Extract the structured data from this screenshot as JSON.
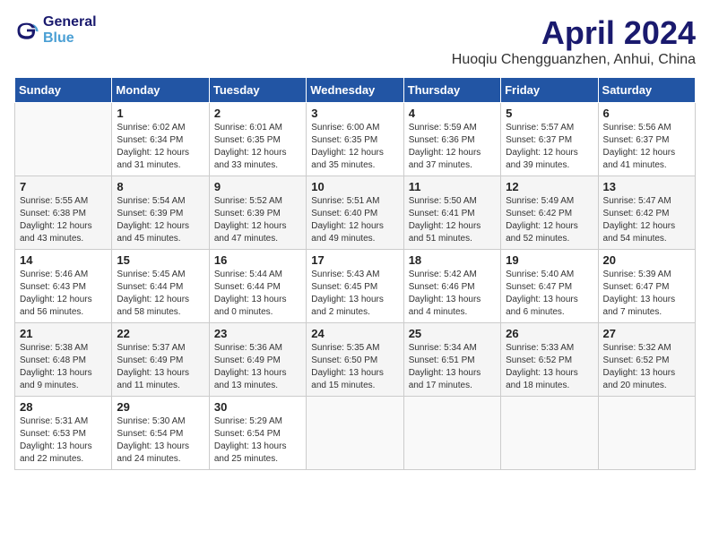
{
  "header": {
    "logo_line1": "General",
    "logo_line2": "Blue",
    "title": "April 2024",
    "location": "Huoqiu Chengguanzhen, Anhui, China"
  },
  "columns": [
    "Sunday",
    "Monday",
    "Tuesday",
    "Wednesday",
    "Thursday",
    "Friday",
    "Saturday"
  ],
  "weeks": [
    [
      {
        "day": "",
        "info": ""
      },
      {
        "day": "1",
        "info": "Sunrise: 6:02 AM\nSunset: 6:34 PM\nDaylight: 12 hours\nand 31 minutes."
      },
      {
        "day": "2",
        "info": "Sunrise: 6:01 AM\nSunset: 6:35 PM\nDaylight: 12 hours\nand 33 minutes."
      },
      {
        "day": "3",
        "info": "Sunrise: 6:00 AM\nSunset: 6:35 PM\nDaylight: 12 hours\nand 35 minutes."
      },
      {
        "day": "4",
        "info": "Sunrise: 5:59 AM\nSunset: 6:36 PM\nDaylight: 12 hours\nand 37 minutes."
      },
      {
        "day": "5",
        "info": "Sunrise: 5:57 AM\nSunset: 6:37 PM\nDaylight: 12 hours\nand 39 minutes."
      },
      {
        "day": "6",
        "info": "Sunrise: 5:56 AM\nSunset: 6:37 PM\nDaylight: 12 hours\nand 41 minutes."
      }
    ],
    [
      {
        "day": "7",
        "info": "Sunrise: 5:55 AM\nSunset: 6:38 PM\nDaylight: 12 hours\nand 43 minutes."
      },
      {
        "day": "8",
        "info": "Sunrise: 5:54 AM\nSunset: 6:39 PM\nDaylight: 12 hours\nand 45 minutes."
      },
      {
        "day": "9",
        "info": "Sunrise: 5:52 AM\nSunset: 6:39 PM\nDaylight: 12 hours\nand 47 minutes."
      },
      {
        "day": "10",
        "info": "Sunrise: 5:51 AM\nSunset: 6:40 PM\nDaylight: 12 hours\nand 49 minutes."
      },
      {
        "day": "11",
        "info": "Sunrise: 5:50 AM\nSunset: 6:41 PM\nDaylight: 12 hours\nand 51 minutes."
      },
      {
        "day": "12",
        "info": "Sunrise: 5:49 AM\nSunset: 6:42 PM\nDaylight: 12 hours\nand 52 minutes."
      },
      {
        "day": "13",
        "info": "Sunrise: 5:47 AM\nSunset: 6:42 PM\nDaylight: 12 hours\nand 54 minutes."
      }
    ],
    [
      {
        "day": "14",
        "info": "Sunrise: 5:46 AM\nSunset: 6:43 PM\nDaylight: 12 hours\nand 56 minutes."
      },
      {
        "day": "15",
        "info": "Sunrise: 5:45 AM\nSunset: 6:44 PM\nDaylight: 12 hours\nand 58 minutes."
      },
      {
        "day": "16",
        "info": "Sunrise: 5:44 AM\nSunset: 6:44 PM\nDaylight: 13 hours\nand 0 minutes."
      },
      {
        "day": "17",
        "info": "Sunrise: 5:43 AM\nSunset: 6:45 PM\nDaylight: 13 hours\nand 2 minutes."
      },
      {
        "day": "18",
        "info": "Sunrise: 5:42 AM\nSunset: 6:46 PM\nDaylight: 13 hours\nand 4 minutes."
      },
      {
        "day": "19",
        "info": "Sunrise: 5:40 AM\nSunset: 6:47 PM\nDaylight: 13 hours\nand 6 minutes."
      },
      {
        "day": "20",
        "info": "Sunrise: 5:39 AM\nSunset: 6:47 PM\nDaylight: 13 hours\nand 7 minutes."
      }
    ],
    [
      {
        "day": "21",
        "info": "Sunrise: 5:38 AM\nSunset: 6:48 PM\nDaylight: 13 hours\nand 9 minutes."
      },
      {
        "day": "22",
        "info": "Sunrise: 5:37 AM\nSunset: 6:49 PM\nDaylight: 13 hours\nand 11 minutes."
      },
      {
        "day": "23",
        "info": "Sunrise: 5:36 AM\nSunset: 6:49 PM\nDaylight: 13 hours\nand 13 minutes."
      },
      {
        "day": "24",
        "info": "Sunrise: 5:35 AM\nSunset: 6:50 PM\nDaylight: 13 hours\nand 15 minutes."
      },
      {
        "day": "25",
        "info": "Sunrise: 5:34 AM\nSunset: 6:51 PM\nDaylight: 13 hours\nand 17 minutes."
      },
      {
        "day": "26",
        "info": "Sunrise: 5:33 AM\nSunset: 6:52 PM\nDaylight: 13 hours\nand 18 minutes."
      },
      {
        "day": "27",
        "info": "Sunrise: 5:32 AM\nSunset: 6:52 PM\nDaylight: 13 hours\nand 20 minutes."
      }
    ],
    [
      {
        "day": "28",
        "info": "Sunrise: 5:31 AM\nSunset: 6:53 PM\nDaylight: 13 hours\nand 22 minutes."
      },
      {
        "day": "29",
        "info": "Sunrise: 5:30 AM\nSunset: 6:54 PM\nDaylight: 13 hours\nand 24 minutes."
      },
      {
        "day": "30",
        "info": "Sunrise: 5:29 AM\nSunset: 6:54 PM\nDaylight: 13 hours\nand 25 minutes."
      },
      {
        "day": "",
        "info": ""
      },
      {
        "day": "",
        "info": ""
      },
      {
        "day": "",
        "info": ""
      },
      {
        "day": "",
        "info": ""
      }
    ]
  ]
}
